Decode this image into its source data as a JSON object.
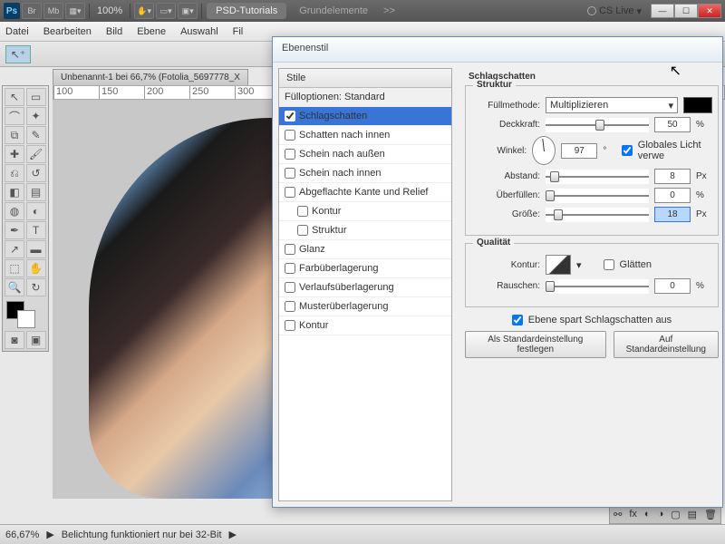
{
  "topbar": {
    "zoom": "100%",
    "tabs": [
      "PSD-Tutorials",
      "Grundelemente"
    ],
    "more": ">>",
    "cslive": "CS Live"
  },
  "menu": [
    "Datei",
    "Bearbeiten",
    "Bild",
    "Ebene",
    "Auswahl",
    "Fil"
  ],
  "doc_tab": "Unbenannt-1 bei 66,7% (Fotolia_5697778_X",
  "ruler": [
    "100",
    "150",
    "200",
    "250",
    "300"
  ],
  "dialog": {
    "title": "Ebenenstil",
    "list_header": "Stile",
    "fill_opt": "Fülloptionen: Standard",
    "styles": [
      {
        "label": "Schlagschatten",
        "checked": true,
        "sel": true
      },
      {
        "label": "Schatten nach innen",
        "checked": false
      },
      {
        "label": "Schein nach außen",
        "checked": false
      },
      {
        "label": "Schein nach innen",
        "checked": false
      },
      {
        "label": "Abgeflachte Kante und Relief",
        "checked": false
      },
      {
        "label": "Kontur",
        "checked": false,
        "sub": true
      },
      {
        "label": "Struktur",
        "checked": false,
        "sub": true
      },
      {
        "label": "Glanz",
        "checked": false
      },
      {
        "label": "Farbüberlagerung",
        "checked": false
      },
      {
        "label": "Verlaufsüberlagerung",
        "checked": false
      },
      {
        "label": "Musterüberlagerung",
        "checked": false
      },
      {
        "label": "Kontur",
        "checked": false
      }
    ],
    "section": "Schlagschatten",
    "struktur": "Struktur",
    "fillmethod_lbl": "Füllmethode:",
    "fillmethod": "Multiplizieren",
    "opacity_lbl": "Deckkraft:",
    "opacity": "50",
    "pct": "%",
    "angle_lbl": "Winkel:",
    "angle": "97",
    "deg": "°",
    "global": "Globales Licht verwe",
    "distance_lbl": "Abstand:",
    "distance": "8",
    "px": "Px",
    "spread_lbl": "Überfüllen:",
    "spread": "0",
    "size_lbl": "Größe:",
    "size": "18",
    "quality": "Qualität",
    "contour_lbl": "Kontur:",
    "antialias": "Glätten",
    "noise_lbl": "Rauschen:",
    "noise": "0",
    "knockout": "Ebene spart Schlagschatten aus",
    "btn_default": "Als Standardeinstellung festlegen",
    "btn_reset": "Auf Standardeinstellung"
  },
  "status": {
    "zoom": "66,67%",
    "msg": "Belichtung funktioniert nur bei 32-Bit"
  }
}
